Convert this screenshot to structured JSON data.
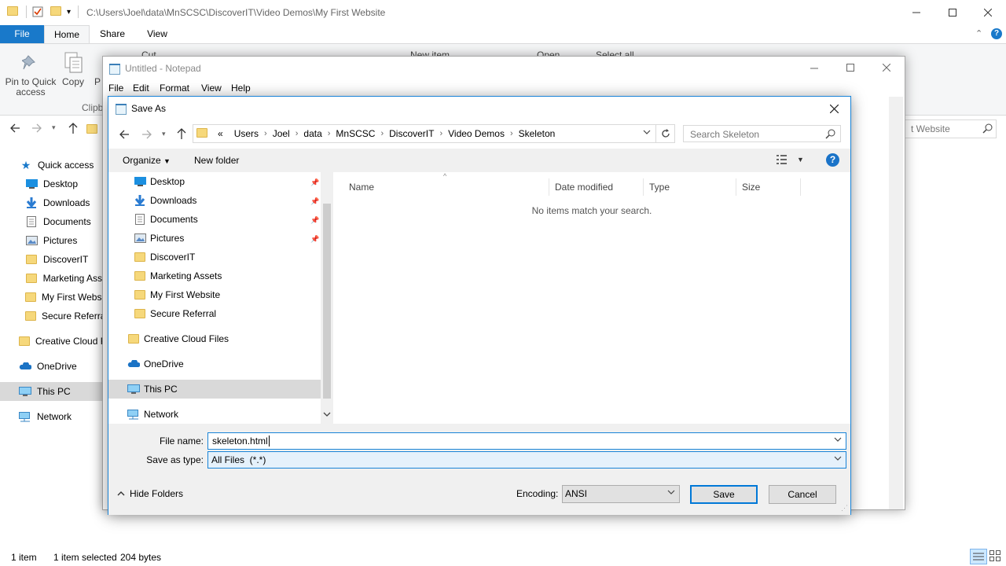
{
  "explorer": {
    "path": "C:\\Users\\Joel\\data\\MnSCSC\\DiscoverIT\\Video Demos\\My First Website",
    "tabs": {
      "file": "File",
      "home": "Home",
      "share": "Share",
      "view": "View"
    },
    "ribbon": {
      "pin_label": "Pin to Quick access",
      "copy_label": "Copy",
      "paste_label": "P",
      "clipboard_group": "Clipb",
      "cut_label": "Cut",
      "new_item_label": "New item",
      "open_label": "Open",
      "select_all_label": "Select all"
    },
    "search_placeholder": "t Website",
    "nav": [
      "Quick access",
      "Desktop",
      "Downloads",
      "Documents",
      "Pictures",
      "DiscoverIT",
      "Marketing Ass",
      "My First Websi",
      "Secure Referral",
      "Creative Cloud F",
      "OneDrive",
      "This PC",
      "Network"
    ],
    "status": {
      "items": "1 item",
      "selected": "1 item selected",
      "size": "204 bytes"
    }
  },
  "notepad": {
    "title": "Untitled - Notepad",
    "menu": [
      "File",
      "Edit",
      "Format",
      "View",
      "Help"
    ]
  },
  "dialog": {
    "title": "Save As",
    "address": {
      "overflow": "«",
      "crumbs": [
        "Users",
        "Joel",
        "data",
        "MnSCSC",
        "DiscoverIT",
        "Video Demos",
        "Skeleton"
      ]
    },
    "search_placeholder": "Search Skeleton",
    "toolbar": {
      "organize": "Organize",
      "new_folder": "New folder"
    },
    "nav": [
      "Desktop",
      "Downloads",
      "Documents",
      "Pictures",
      "DiscoverIT",
      "Marketing Assets",
      "My First Website",
      "Secure Referral",
      "Creative Cloud Files",
      "OneDrive",
      "This PC",
      "Network"
    ],
    "columns": [
      "Name",
      "Date modified",
      "Type",
      "Size"
    ],
    "empty_message": "No items match your search.",
    "file_name_label": "File name:",
    "file_name_value": "skeleton.html",
    "save_type_label": "Save as type:",
    "save_type_value": "All Files  (*.*)",
    "hide_folders": "Hide Folders",
    "encoding_label": "Encoding:",
    "encoding_value": "ANSI",
    "save_button": "Save",
    "cancel_button": "Cancel"
  },
  "colors": {
    "accent": "#1979ca",
    "folder": "#f6d87b",
    "selected": "#d9d9d9"
  }
}
